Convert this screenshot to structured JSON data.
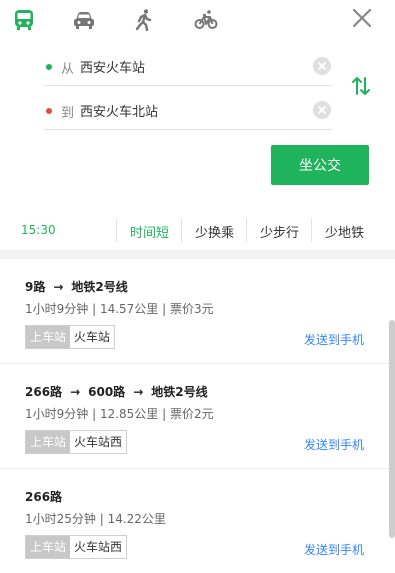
{
  "modes": [
    {
      "name": "bus",
      "active": true
    },
    {
      "name": "car",
      "active": false
    },
    {
      "name": "walk",
      "active": false
    },
    {
      "name": "bike",
      "active": false
    }
  ],
  "from": {
    "prefix": "从",
    "value": "西安火车站"
  },
  "to": {
    "prefix": "到",
    "value": "西安火车北站"
  },
  "go_label": "坐公交",
  "filter": {
    "time": "15:30",
    "tabs": [
      "时间短",
      "少换乘",
      "少步行",
      "少地铁"
    ],
    "active_tab": 0
  },
  "routes": [
    {
      "segments": [
        "9路",
        "地铁2号线"
      ],
      "meta": "1小时9分钟 | 14.57公里 | 票价3元",
      "stop_label": "上车站",
      "stop": "火车站",
      "send": "发送到手机"
    },
    {
      "segments": [
        "266路",
        "600路",
        "地铁2号线"
      ],
      "meta": "1小时9分钟 | 12.85公里 | 票价2元",
      "stop_label": "上车站",
      "stop": "火车站西",
      "send": "发送到手机"
    },
    {
      "segments": [
        "266路"
      ],
      "meta": "1小时25分钟 | 14.22公里",
      "stop_label": "上车站",
      "stop": "火车站西",
      "send": "发送到手机"
    }
  ],
  "colors": {
    "accent": "#1fb45b",
    "link": "#3385ff",
    "from_dot": "#1fb45b",
    "to_dot": "#e94b3c"
  }
}
